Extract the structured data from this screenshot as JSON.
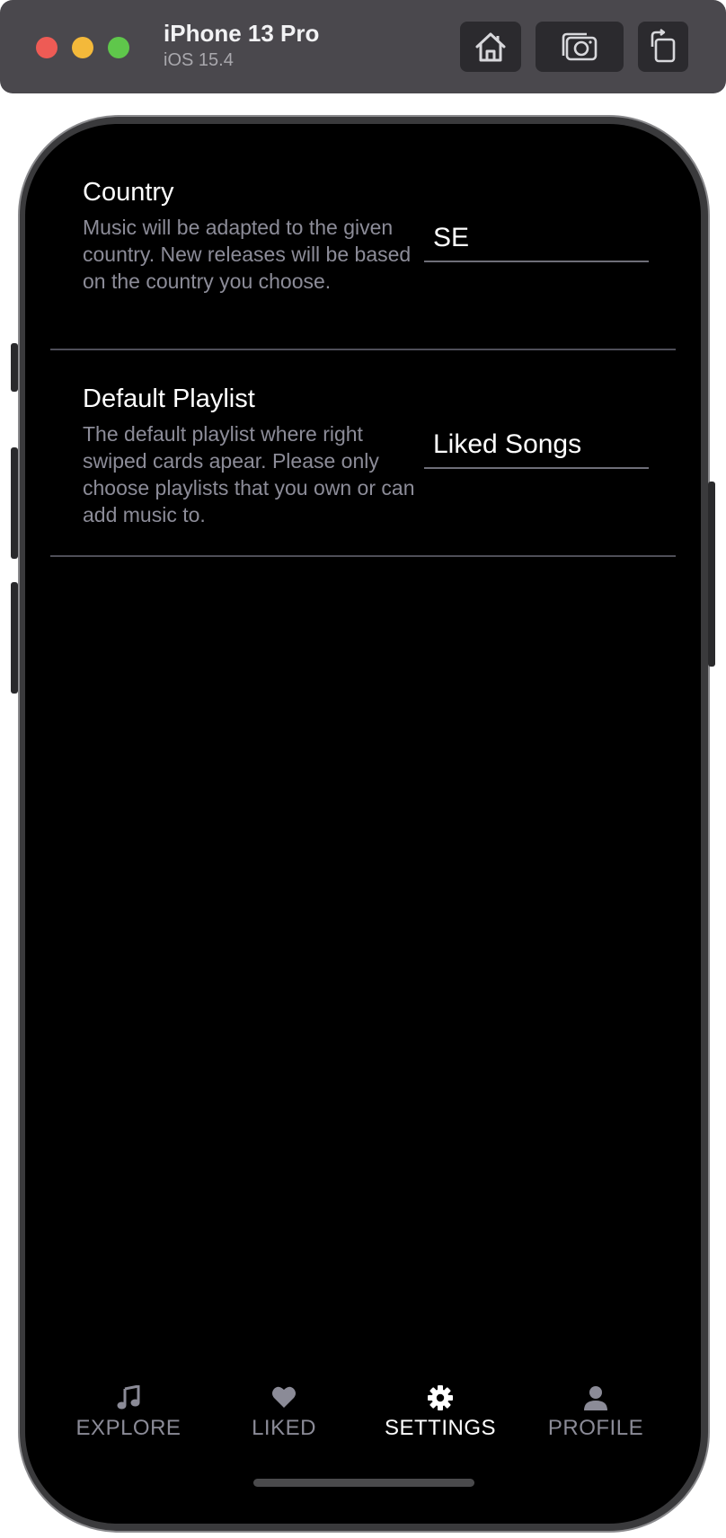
{
  "simulator": {
    "device_name": "iPhone 13 Pro",
    "os_version": "iOS 15.4",
    "icons": {
      "home": "home-icon",
      "screenshot": "camera-icon",
      "rotate": "rotate-icon"
    }
  },
  "settings": {
    "country": {
      "title": "Country",
      "description": "Music will be adapted to the given country. New releases will be based on the country you choose.",
      "value": "SE"
    },
    "default_playlist": {
      "title": "Default Playlist",
      "description": "The default playlist where right swiped cards apear. Please only choose playlists that you own or can add music to.",
      "value": "Liked Songs"
    }
  },
  "tabs": [
    {
      "label": "EXPLORE",
      "icon": "music-note-icon",
      "active": false
    },
    {
      "label": "LIKED",
      "icon": "heart-icon",
      "active": false
    },
    {
      "label": "SETTINGS",
      "icon": "gear-icon",
      "active": true
    },
    {
      "label": "PROFILE",
      "icon": "person-icon",
      "active": false
    }
  ],
  "colors": {
    "background": "#000000",
    "text_primary": "#ffffff",
    "text_secondary": "#8c8c98",
    "divider": "#4e4e58",
    "tab_inactive": "#8b8b97",
    "tab_active": "#ffffff"
  }
}
